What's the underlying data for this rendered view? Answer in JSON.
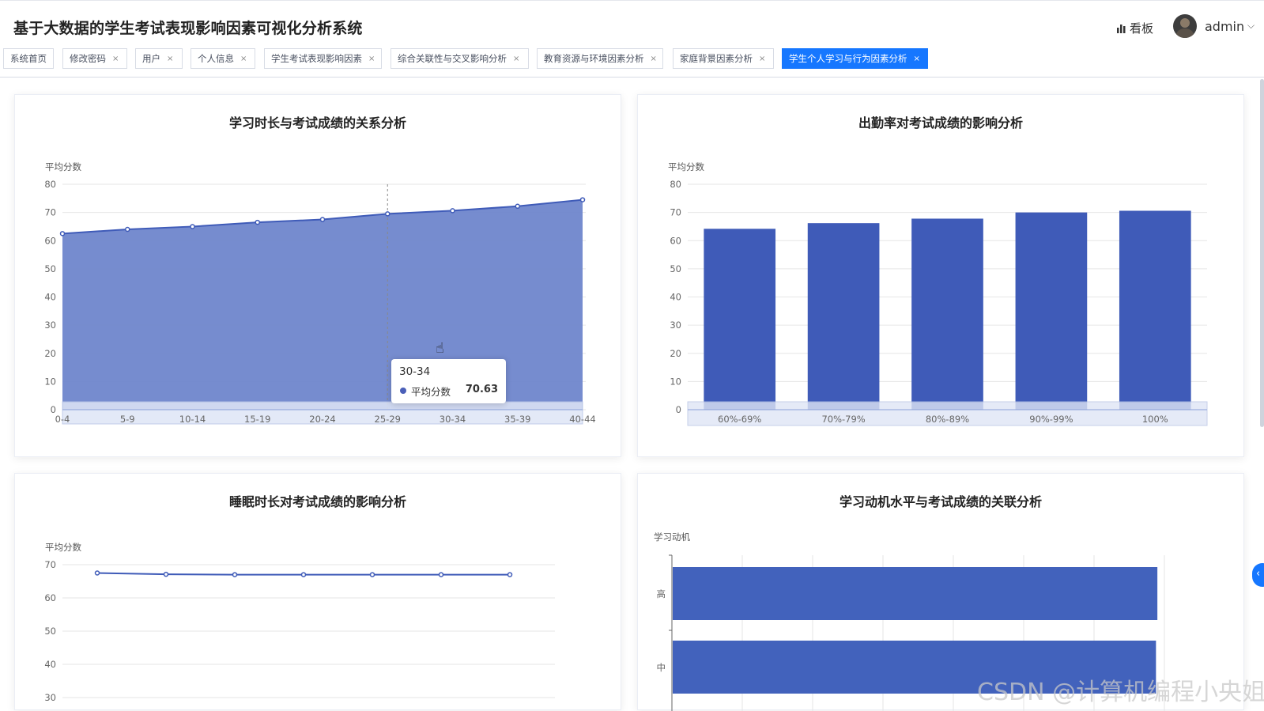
{
  "header": {
    "title": "基于大数据的学生考试表现影响因素可视化分析系统",
    "board_label": "看板",
    "user_name": "admin"
  },
  "tabs": [
    {
      "label": "系统首页",
      "closable": false,
      "active": false
    },
    {
      "label": "修改密码",
      "closable": true,
      "active": false
    },
    {
      "label": "用户",
      "closable": true,
      "active": false
    },
    {
      "label": "个人信息",
      "closable": true,
      "active": false
    },
    {
      "label": "学生考试表现影响因素",
      "closable": true,
      "active": false
    },
    {
      "label": "综合关联性与交叉影响分析",
      "closable": true,
      "active": false
    },
    {
      "label": "教育资源与环境因素分析",
      "closable": true,
      "active": false
    },
    {
      "label": "家庭背景因素分析",
      "closable": true,
      "active": false
    },
    {
      "label": "学生个人学习与行为因素分析",
      "closable": true,
      "active": true
    }
  ],
  "close_glyph": "×",
  "tooltip": {
    "category": "30-34",
    "series": "平均分数",
    "value": "70.63"
  },
  "watermark": "CSDN @计算机编程小央姐",
  "colors": {
    "accent": "#1677ff",
    "series": "#3f5bb8",
    "area": "#6f86cc"
  },
  "chart_data": [
    {
      "type": "area",
      "title": "学习时长与考试成绩的关系分析",
      "ylabel": "平均分数",
      "categories": [
        "0-4",
        "5-9",
        "10-14",
        "15-19",
        "20-24",
        "25-29",
        "30-34",
        "35-39",
        "40-44"
      ],
      "series": [
        {
          "name": "平均分数",
          "values": [
            62.5,
            64.0,
            65.0,
            66.5,
            67.5,
            69.5,
            70.63,
            72.2,
            74.5
          ]
        }
      ],
      "ylim": [
        0,
        80
      ],
      "yticks": [
        0,
        10,
        20,
        30,
        40,
        50,
        60,
        70,
        80
      ],
      "grid": true
    },
    {
      "type": "bar",
      "title": "出勤率对考试成绩的影响分析",
      "ylabel": "平均分数",
      "categories": [
        "60%-69%",
        "70%-79%",
        "80%-89%",
        "90%-99%",
        "100%"
      ],
      "series": [
        {
          "name": "平均分数",
          "values": [
            64.2,
            66.2,
            67.8,
            70.0,
            70.6
          ]
        }
      ],
      "ylim": [
        0,
        80
      ],
      "yticks": [
        0,
        10,
        20,
        30,
        40,
        50,
        60,
        70,
        80
      ],
      "grid": true
    },
    {
      "type": "line",
      "title": "睡眠时长对考试成绩的影响分析",
      "ylabel": "平均分数",
      "series": [
        {
          "name": "平均分数",
          "values": [
            67.5,
            67.1,
            67.0,
            67.0,
            67.0,
            67.0,
            67.0
          ]
        }
      ],
      "ylim": [
        30,
        70
      ],
      "yticks": [
        30,
        40,
        50,
        60,
        70
      ],
      "grid": true
    },
    {
      "type": "bar",
      "orientation": "horizontal",
      "title": "学习动机水平与考试成绩的关联分析",
      "ylabel": "学习动机",
      "categories": [
        "高",
        "中"
      ],
      "series": [
        {
          "name": "平均分数",
          "values": [
            69.0,
            68.8
          ]
        }
      ],
      "xlim": [
        0,
        70
      ],
      "grid": true
    }
  ]
}
